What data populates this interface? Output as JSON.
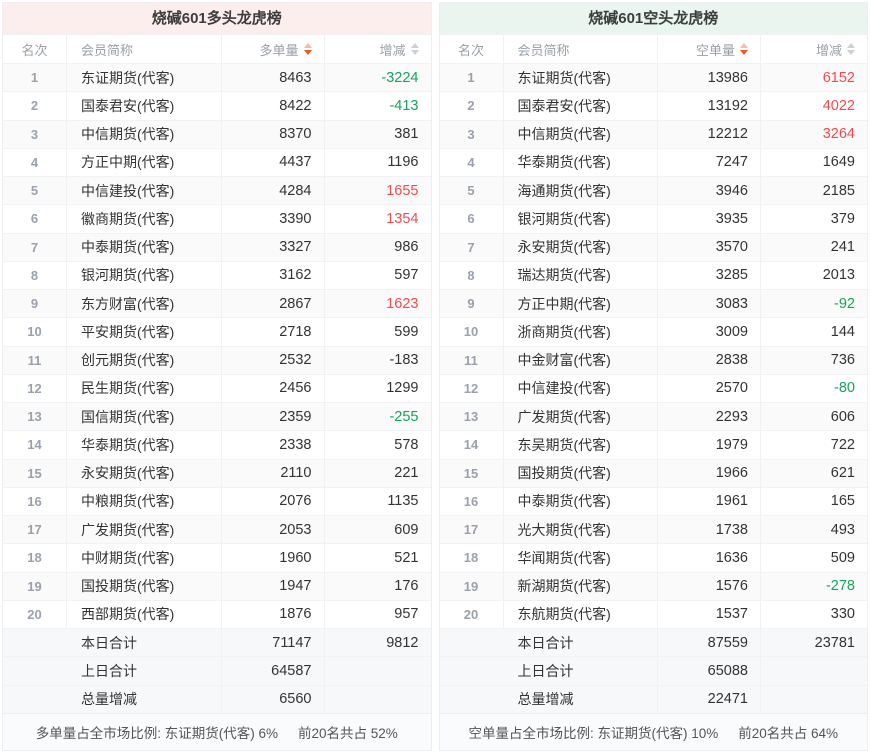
{
  "colors": {
    "long-title-bg": "#fdeeee",
    "short-title-bg": "#e9f5ee",
    "red": "#f8484c",
    "green": "#17a25d",
    "sort-active": "#f2581f",
    "sort-active-faded": "#f0bda6",
    "sort-inactive": "#ccd1d9"
  },
  "tables": [
    {
      "title": "烧碱601多头龙虎榜",
      "columns": {
        "rank": "名次",
        "member": "会员简称",
        "volume": "多单量",
        "change": "增减"
      },
      "sort_icons": {
        "volume": "sort-caret-active-desc",
        "change": "sort-caret-inactive"
      },
      "rows": [
        {
          "rank": 1,
          "member": "东证期货(代客)",
          "volume": "8463",
          "change": "-3224",
          "change_color": "green"
        },
        {
          "rank": 2,
          "member": "国泰君安(代客)",
          "volume": "8422",
          "change": "-413",
          "change_color": "green"
        },
        {
          "rank": 3,
          "member": "中信期货(代客)",
          "volume": "8370",
          "change": "381",
          "change_color": "default"
        },
        {
          "rank": 4,
          "member": "方正中期(代客)",
          "volume": "4437",
          "change": "1196",
          "change_color": "default"
        },
        {
          "rank": 5,
          "member": "中信建投(代客)",
          "volume": "4284",
          "change": "1655",
          "change_color": "red"
        },
        {
          "rank": 6,
          "member": "徽商期货(代客)",
          "volume": "3390",
          "change": "1354",
          "change_color": "red"
        },
        {
          "rank": 7,
          "member": "中泰期货(代客)",
          "volume": "3327",
          "change": "986",
          "change_color": "default"
        },
        {
          "rank": 8,
          "member": "银河期货(代客)",
          "volume": "3162",
          "change": "597",
          "change_color": "default"
        },
        {
          "rank": 9,
          "member": "东方财富(代客)",
          "volume": "2867",
          "change": "1623",
          "change_color": "red"
        },
        {
          "rank": 10,
          "member": "平安期货(代客)",
          "volume": "2718",
          "change": "599",
          "change_color": "default"
        },
        {
          "rank": 11,
          "member": "创元期货(代客)",
          "volume": "2532",
          "change": "-183",
          "change_color": "default"
        },
        {
          "rank": 12,
          "member": "民生期货(代客)",
          "volume": "2456",
          "change": "1299",
          "change_color": "default"
        },
        {
          "rank": 13,
          "member": "国信期货(代客)",
          "volume": "2359",
          "change": "-255",
          "change_color": "green"
        },
        {
          "rank": 14,
          "member": "华泰期货(代客)",
          "volume": "2338",
          "change": "578",
          "change_color": "default"
        },
        {
          "rank": 15,
          "member": "永安期货(代客)",
          "volume": "2110",
          "change": "221",
          "change_color": "default"
        },
        {
          "rank": 16,
          "member": "中粮期货(代客)",
          "volume": "2076",
          "change": "1135",
          "change_color": "default"
        },
        {
          "rank": 17,
          "member": "广发期货(代客)",
          "volume": "2053",
          "change": "609",
          "change_color": "default"
        },
        {
          "rank": 18,
          "member": "中财期货(代客)",
          "volume": "1960",
          "change": "521",
          "change_color": "default"
        },
        {
          "rank": 19,
          "member": "国投期货(代客)",
          "volume": "1947",
          "change": "176",
          "change_color": "default"
        },
        {
          "rank": 20,
          "member": "西部期货(代客)",
          "volume": "1876",
          "change": "957",
          "change_color": "default"
        }
      ],
      "summary": [
        {
          "label": "本日合计",
          "volume": "71147",
          "change": "9812"
        },
        {
          "label": "上日合计",
          "volume": "64587",
          "change": ""
        },
        {
          "label": "总量增减",
          "volume": "6560",
          "change": ""
        }
      ],
      "note_main": "多单量占全市场比例: 东证期货(代客) 6%",
      "note_extra": "前20名共占 52%"
    },
    {
      "title": "烧碱601空头龙虎榜",
      "columns": {
        "rank": "名次",
        "member": "会员简称",
        "volume": "空单量",
        "change": "增减"
      },
      "sort_icons": {
        "volume": "sort-caret-active-desc",
        "change": "sort-caret-inactive"
      },
      "rows": [
        {
          "rank": 1,
          "member": "东证期货(代客)",
          "volume": "13986",
          "change": "6152",
          "change_color": "red"
        },
        {
          "rank": 2,
          "member": "国泰君安(代客)",
          "volume": "13192",
          "change": "4022",
          "change_color": "red"
        },
        {
          "rank": 3,
          "member": "中信期货(代客)",
          "volume": "12212",
          "change": "3264",
          "change_color": "red"
        },
        {
          "rank": 4,
          "member": "华泰期货(代客)",
          "volume": "7247",
          "change": "1649",
          "change_color": "default"
        },
        {
          "rank": 5,
          "member": "海通期货(代客)",
          "volume": "3946",
          "change": "2185",
          "change_color": "default"
        },
        {
          "rank": 6,
          "member": "银河期货(代客)",
          "volume": "3935",
          "change": "379",
          "change_color": "default"
        },
        {
          "rank": 7,
          "member": "永安期货(代客)",
          "volume": "3570",
          "change": "241",
          "change_color": "default"
        },
        {
          "rank": 8,
          "member": "瑞达期货(代客)",
          "volume": "3285",
          "change": "2013",
          "change_color": "default"
        },
        {
          "rank": 9,
          "member": "方正中期(代客)",
          "volume": "3083",
          "change": "-92",
          "change_color": "green"
        },
        {
          "rank": 10,
          "member": "浙商期货(代客)",
          "volume": "3009",
          "change": "144",
          "change_color": "default"
        },
        {
          "rank": 11,
          "member": "中金财富(代客)",
          "volume": "2838",
          "change": "736",
          "change_color": "default"
        },
        {
          "rank": 12,
          "member": "中信建投(代客)",
          "volume": "2570",
          "change": "-80",
          "change_color": "green"
        },
        {
          "rank": 13,
          "member": "广发期货(代客)",
          "volume": "2293",
          "change": "606",
          "change_color": "default"
        },
        {
          "rank": 14,
          "member": "东吴期货(代客)",
          "volume": "1979",
          "change": "722",
          "change_color": "default"
        },
        {
          "rank": 15,
          "member": "国投期货(代客)",
          "volume": "1966",
          "change": "621",
          "change_color": "default"
        },
        {
          "rank": 16,
          "member": "中泰期货(代客)",
          "volume": "1961",
          "change": "165",
          "change_color": "default"
        },
        {
          "rank": 17,
          "member": "光大期货(代客)",
          "volume": "1738",
          "change": "493",
          "change_color": "default"
        },
        {
          "rank": 18,
          "member": "华闻期货(代客)",
          "volume": "1636",
          "change": "509",
          "change_color": "default"
        },
        {
          "rank": 19,
          "member": "新湖期货(代客)",
          "volume": "1576",
          "change": "-278",
          "change_color": "green"
        },
        {
          "rank": 20,
          "member": "东航期货(代客)",
          "volume": "1537",
          "change": "330",
          "change_color": "default"
        }
      ],
      "summary": [
        {
          "label": "本日合计",
          "volume": "87559",
          "change": "23781"
        },
        {
          "label": "上日合计",
          "volume": "65088",
          "change": ""
        },
        {
          "label": "总量增减",
          "volume": "22471",
          "change": ""
        }
      ],
      "note_main": "空单量占全市场比例: 东证期货(代客) 10%",
      "note_extra": "前20名共占 64%"
    }
  ]
}
